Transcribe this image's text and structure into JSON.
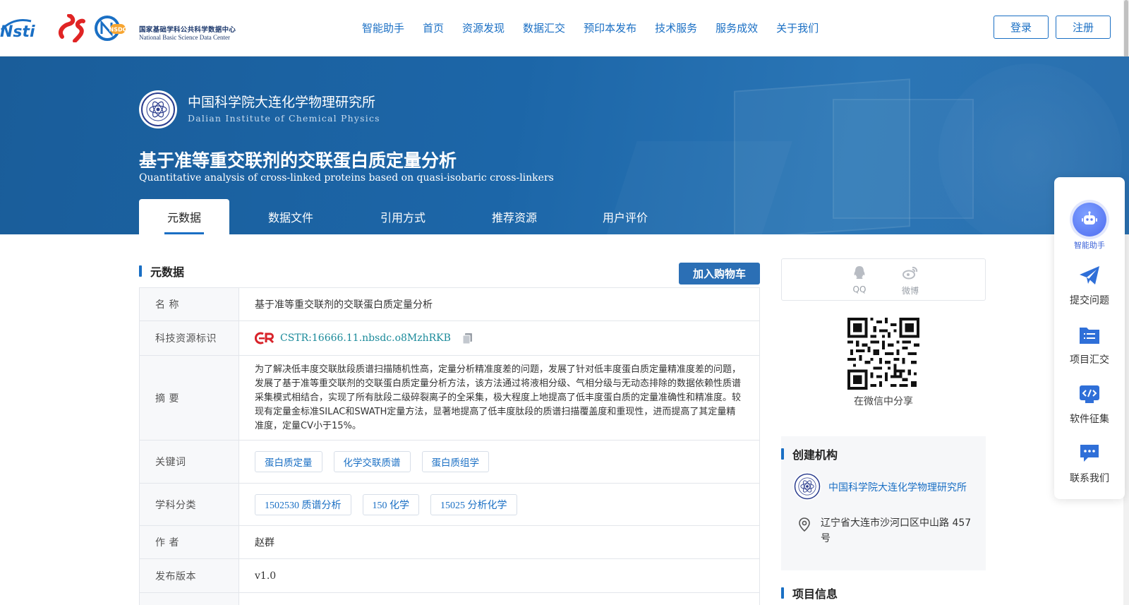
{
  "logos": {
    "nsti_text": "Nsti",
    "nsdc_badge": "NSDC",
    "nsdc_cn": "国家基础学科公共科学数据中心",
    "nsdc_en": "National Basic Science Data Center"
  },
  "nav": {
    "items": [
      "智能助手",
      "首页",
      "资源发现",
      "数据汇交",
      "预印本发布",
      "技术服务",
      "服务成效",
      "关于我们"
    ],
    "login": "登录",
    "register": "注册"
  },
  "banner": {
    "institution_cn": "中国科学院大连化学物理研究所",
    "institution_en": "Dalian Institute of Chemical Physics",
    "title": "基于准等重交联剂的交联蛋白质定量分析",
    "subtitle": "Quantitative analysis of cross-linked proteins based on quasi-isobaric cross-linkers",
    "tabs": [
      "元数据",
      "数据文件",
      "引用方式",
      "推荐资源",
      "用户评价"
    ],
    "active_tab": "元数据"
  },
  "metadata": {
    "section_title": "元数据",
    "cart_button": "加入购物车",
    "rows": {
      "name_label": "名 称",
      "name_value": "基于准等重交联剂的交联蛋白质定量分析",
      "id_label": "科技资源标识",
      "id_value": "CSTR:16666.11.nbsdc.o8MzhRKB",
      "abstract_label": "摘 要",
      "abstract_value": "为了解决低丰度交联肽段质谱扫描随机性高，定量分析精准度差的问题，发展了针对低丰度蛋白质定量精准度差的问题，发展了基于准等重交联剂的交联蛋白质定量分析方法，该方法通过将液相分级、气相分级与无动态排除的数据依赖性质谱采集模式相结合，实现了所有肽段二级碎裂离子的全采集，极大程度上地提高了低丰度蛋白质的定量准确性和精准度。较现有定量金标准SILAC和SWATH定量方法，显著地提高了低丰度肽段的质谱扫描覆盖度和重现性，进而提高了其定量精准度，定量CV小于15%。",
      "keywords_label": "关键词",
      "keywords": [
        "蛋白质定量",
        "化学交联质谱",
        "蛋白质组学"
      ],
      "subject_label": "学科分类",
      "subjects": [
        "1502530 质谱分析",
        "150 化学",
        "15025 分析化学"
      ],
      "author_label": "作 者",
      "author_value": "赵群",
      "version_label": "发布版本",
      "version_value": "v1.0"
    }
  },
  "share": {
    "qq": "QQ",
    "weibo": "微博",
    "wechat_caption": "在微信中分享"
  },
  "organization": {
    "section_title": "创建机构",
    "name": "中国科学院大连化学物理研究所",
    "address": "辽宁省大连市沙河口区中山路 457 号"
  },
  "project": {
    "section_title": "项目信息"
  },
  "side_panel": {
    "ai_assistant": "智能助手",
    "submit_question": "提交问题",
    "project_collection": "项目汇交",
    "software_collection": "软件征集",
    "contact_us": "联系我们"
  },
  "colors": {
    "brand_blue": "#1a6fc4",
    "banner_blue": "#1c66a8",
    "cart_button": "#2b6fb5",
    "cstr_teal": "#1a8a9a",
    "ai_purple": "#5d7af0"
  }
}
